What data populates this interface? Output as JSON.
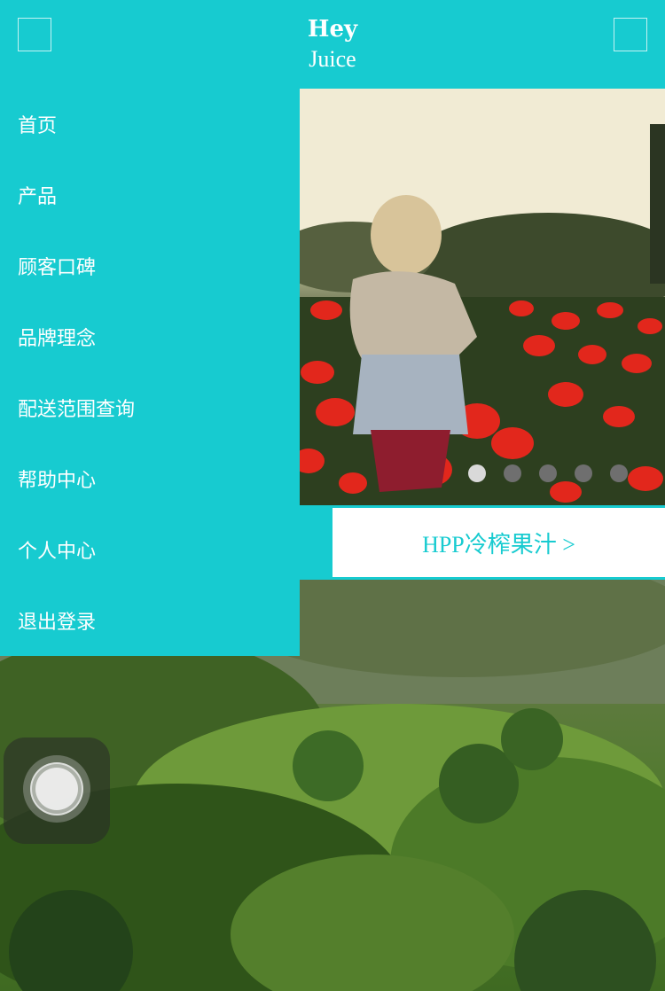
{
  "header": {
    "brand_line1": "Hey",
    "brand_line2": "Juice",
    "left_button_icon": "menu-square-icon",
    "right_button_icon": "square-icon"
  },
  "menu": {
    "items": [
      {
        "label": "首页"
      },
      {
        "label": "产品"
      },
      {
        "label": "顾客口碑"
      },
      {
        "label": "品牌理念"
      },
      {
        "label": "配送范围查询"
      },
      {
        "label": "帮助中心"
      },
      {
        "label": "个人中心"
      },
      {
        "label": "退出登录"
      }
    ]
  },
  "carousel": {
    "slide_count": 5,
    "active_index": 0
  },
  "product_link": {
    "label": "HPP冷榨果汁 >"
  },
  "colors": {
    "accent": "#17cbd0",
    "white": "#ffffff",
    "dot_active": "#d9d9d9",
    "dot_inactive": "#6f6f6f"
  }
}
